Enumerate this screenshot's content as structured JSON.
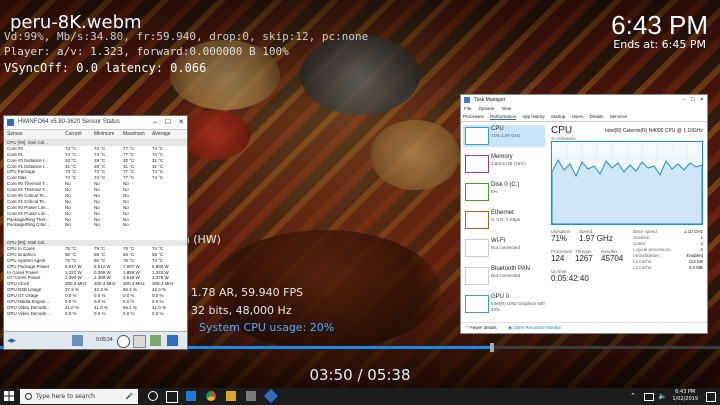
{
  "player": {
    "filename": "peru-8K.webm",
    "stats_line1": "Vd:99%, Mb/s:34.80, fr:59.940, drop:0, skip:12, pc:none",
    "stats_line2": "Player: a/v: 1.323,  forward:0.000000 B 100%",
    "stats_line3": "VSyncOff: 0.0 latency: 0.066",
    "clock": "6:43 PM",
    "ends_at": "Ends at: 6:45 PM",
    "codec_fragment": "a (HW)",
    "fps_line": "1.78 AR, 59.940 FPS",
    "audio_line": "32 bits, 48,000 Hz",
    "cpu_usage": "System CPU usage: 20%",
    "elapsed": "03:50 / 05:38",
    "progress_fraction": 0.68
  },
  "hwinfo": {
    "title": "HWiNFO64 v5.80-3620 Sensor Status",
    "columns": [
      "Sensor",
      "Current",
      "Minimum",
      "Maximum",
      "Average"
    ],
    "rows": [
      {
        "type": "sec",
        "c": [
          "CPU [#0]: Intel Cel...",
          "",
          "",
          "",
          ""
        ]
      },
      {
        "c": [
          "Core #0",
          "73 °C",
          "73 °C",
          "77 °C",
          "74 °C"
        ]
      },
      {
        "c": [
          "Core #1",
          "74 °C",
          "74 °C",
          "77 °C",
          "74 °C"
        ]
      },
      {
        "c": [
          "Core #0 Distance t...",
          "32 °C",
          "28 °C",
          "32 °C",
          "31 °C"
        ]
      },
      {
        "c": [
          "Core #1 Distance t...",
          "31 °C",
          "28 °C",
          "31 °C",
          "31 °C"
        ]
      },
      {
        "c": [
          "CPU Package",
          "73 °C",
          "73 °C",
          "77 °C",
          "74 °C"
        ]
      },
      {
        "c": [
          "Core Max",
          "74 °C",
          "74 °C",
          "77 °C",
          "74 °C"
        ]
      },
      {
        "c": [
          "Core #0 Thermal T...",
          "No",
          "No",
          "No",
          ""
        ]
      },
      {
        "c": [
          "Core #1 Thermal T...",
          "No",
          "No",
          "No",
          ""
        ]
      },
      {
        "c": [
          "Core #0 Critical Te...",
          "No",
          "No",
          "No",
          ""
        ]
      },
      {
        "c": [
          "Core #1 Critical Te...",
          "No",
          "No",
          "No",
          ""
        ]
      },
      {
        "c": [
          "Core #0 Power Lim...",
          "No",
          "No",
          "No",
          ""
        ]
      },
      {
        "c": [
          "Core #1 Power Lim...",
          "No",
          "No",
          "No",
          ""
        ]
      },
      {
        "c": [
          "Package/Ring Ther...",
          "No",
          "No",
          "No",
          ""
        ]
      },
      {
        "c": [
          "Package/Ring Critic...",
          "No",
          "No",
          "No",
          ""
        ]
      },
      {
        "type": "gap",
        "c": [
          "",
          "",
          "",
          "",
          ""
        ]
      },
      {
        "type": "gap",
        "c": [
          "",
          "",
          "",
          "",
          ""
        ]
      },
      {
        "type": "sec",
        "c": [
          "CPU [#0]: Intel Cel...",
          "",
          "",
          "",
          ""
        ]
      },
      {
        "c": [
          "CPU IA Cores",
          "75 °C",
          "75 °C",
          "76 °C",
          "74 °C"
        ]
      },
      {
        "c": [
          "CPU Graphics",
          "56 °C",
          "56 °C",
          "56 °C",
          "55 °C"
        ]
      },
      {
        "c": [
          "CPU System Agent",
          "75 °C",
          "66 °C",
          "76 °C",
          "74 °C"
        ]
      },
      {
        "c": [
          "CPU Package Power",
          "6.517 W",
          "6.512 W",
          "7.007 W",
          "6.800 W"
        ]
      },
      {
        "c": [
          "IA Cores Power",
          "1.221 W",
          "0.399 W",
          "1.959 W",
          "1.343 W"
        ]
      },
      {
        "c": [
          "GT Cores Power",
          "2.393 W",
          "2.389 W",
          "2.518 W",
          "2.379 W"
        ]
      },
      {
        "c": [
          "GPU Clock",
          "300.3 MHz",
          "300.3 MHz",
          "300.3 MHz",
          "300.3 MHz"
        ]
      },
      {
        "c": [
          "GPU D3D Usage",
          "37.2 %",
          "42.3 %",
          "66.2 %",
          "42.3 %"
        ]
      },
      {
        "c": [
          "GPU GT Usage",
          "0.0 %",
          "0.0 %",
          "0.0 %",
          "0.0 %"
        ]
      },
      {
        "c": [
          "GPU Media Engine ...",
          "0.0 %",
          "0.0 %",
          "0.0 %",
          "0.0 %"
        ]
      },
      {
        "c": [
          "GPU Video Decode...",
          "41.0 %",
          "41.0 %",
          "66.1 %",
          "41.0 %"
        ]
      },
      {
        "c": [
          "GPU Video Decode ...",
          "0.0 %",
          "0.0 %",
          "0.0 %",
          "0.0 %"
        ]
      }
    ],
    "timer": "0:05:24"
  },
  "taskmgr": {
    "title": "Task Manager",
    "menu": [
      "File",
      "Options",
      "View"
    ],
    "tabs": [
      "Processes",
      "Performance",
      "App history",
      "Startup",
      "Users",
      "Details",
      "Services"
    ],
    "active_tab": "Performance",
    "side": [
      {
        "name": "CPU",
        "sub": "71%  1.97 GHz"
      },
      {
        "name": "Memory",
        "sub": "2.8/3.8 GB (75%)"
      },
      {
        "name": "Disk 0 (C:)",
        "sub": "6%"
      },
      {
        "name": "Ethernet",
        "sub": "S: 0  R: 0 Kbps"
      },
      {
        "name": "Wi-Fi",
        "sub": "Not connected"
      },
      {
        "name": "Bluetooth PAN",
        "sub": "Not connected"
      },
      {
        "name": "GPU 0",
        "sub": "Intel(R) UHD Graphics 600\n34%"
      }
    ],
    "heading": "CPU",
    "model": "Intel(R) Celeron(R) N4000 CPU @ 1.10GHz",
    "graph_label": "% Utilisation",
    "utilisation_label": "Utilisation",
    "utilisation": "71%",
    "speed_label": "Speed",
    "speed": "1.97 GHz",
    "processes_label": "Processes",
    "processes": "124",
    "threads_label": "Threads",
    "threads": "1267",
    "handles_label": "Handles",
    "handles": "45704",
    "uptime_label": "Up time",
    "uptime": "0:05:42:40",
    "base_speed_label": "Base speed:",
    "base_speed": "1.10 GHz",
    "sockets_label": "Sockets:",
    "sockets": "1",
    "cores_label": "Cores:",
    "cores": "2",
    "logical_label": "Logical processors:",
    "logical": "2",
    "virt_label": "Virtualisation:",
    "virt": "Enabled",
    "l1_label": "L1 cache:",
    "l1": "112 KB",
    "l2_label": "L2 cache:",
    "l2": "4.0 MB",
    "fewer": "Fewer details",
    "monitor": "Open Resource Monitor"
  },
  "taskbar": {
    "search_placeholder": "Type here to search",
    "time": "6:43 PM",
    "date": "1/02/2019"
  },
  "colors": {
    "accent": "#1e88e5",
    "cpu_blue": "#1b8fd6",
    "stats_blue": "#4fa8ff"
  }
}
